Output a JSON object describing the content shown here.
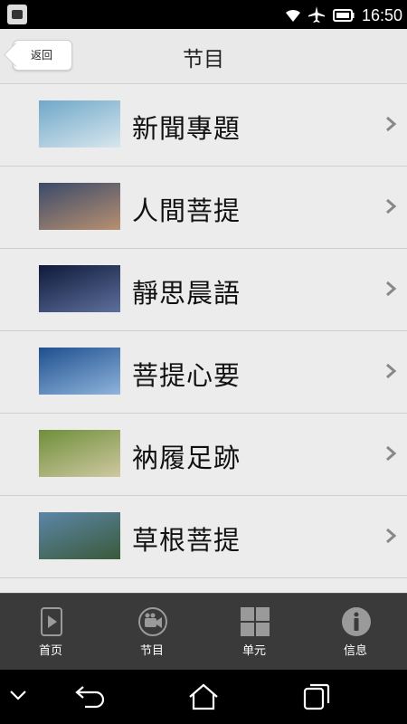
{
  "status_bar": {
    "time": "16:50"
  },
  "header": {
    "back_label": "返回",
    "title": "节目"
  },
  "programs": [
    {
      "label": "新聞專題",
      "thumb_colors": [
        "#6fa8c8",
        "#d8e6ee"
      ]
    },
    {
      "label": "人間菩提",
      "thumb_colors": [
        "#3b4a6a",
        "#b89070"
      ]
    },
    {
      "label": "靜思晨語",
      "thumb_colors": [
        "#0f1a3a",
        "#5d6f9c"
      ]
    },
    {
      "label": "菩提心要",
      "thumb_colors": [
        "#1e4f8e",
        "#8fb4dc"
      ]
    },
    {
      "label": "衲履足跡",
      "thumb_colors": [
        "#6e8f3a",
        "#cfc8a0"
      ]
    },
    {
      "label": "草根菩提",
      "thumb_colors": [
        "#5c86a8",
        "#3a5a3a"
      ]
    },
    {
      "label": "",
      "thumb_colors": [
        "#3a5f8f",
        "#7aa0c8"
      ]
    }
  ],
  "tabbar": [
    {
      "label": "首页",
      "icon": "phone-play-icon"
    },
    {
      "label": "节目",
      "icon": "camera-icon"
    },
    {
      "label": "单元",
      "icon": "grid-icon"
    },
    {
      "label": "信息",
      "icon": "info-icon"
    }
  ]
}
